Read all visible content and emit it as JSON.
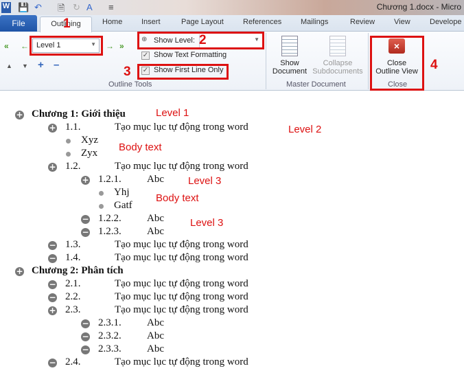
{
  "window": {
    "title": "Chương 1.docx - Micro"
  },
  "tabs": {
    "file": "File",
    "items": [
      "Outlining",
      "Home",
      "Insert",
      "Page Layout",
      "References",
      "Mailings",
      "Review",
      "View",
      "Develope"
    ]
  },
  "ribbon": {
    "outline_tools": {
      "level_value": "Level 1",
      "show_level_label": "Show Level:",
      "show_level_value": "",
      "show_text_formatting": "Show Text Formatting",
      "show_text_formatting_checked": true,
      "show_first_line_only": "Show First Line Only",
      "show_first_line_only_checked": true,
      "group_label": "Outline Tools"
    },
    "master_document": {
      "show_document_1": "Show",
      "show_document_2": "Document",
      "collapse_1": "Collapse",
      "collapse_2": "Subdocuments",
      "group_label": "Master Document"
    },
    "close": {
      "btn_1": "Close",
      "btn_2": "Outline View",
      "group_label": "Close"
    }
  },
  "callouts": [
    "1",
    "2",
    "3",
    "4"
  ],
  "annotations": [
    "Level 1",
    "Level 2",
    "Body text",
    "Level 3",
    "Body text",
    "Level 3"
  ],
  "outline": [
    {
      "level": 1,
      "icon": "plus",
      "num": "",
      "text": "Chương 1: Giới thiệu"
    },
    {
      "level": 2,
      "icon": "plus",
      "num": "1.1.",
      "text": "Tạo mục lục tự động trong word"
    },
    {
      "level": "b2",
      "icon": "bullet",
      "num": "",
      "text": "Xyz"
    },
    {
      "level": "b2",
      "icon": "bullet",
      "num": "",
      "text": "Zyx"
    },
    {
      "level": 2,
      "icon": "plus",
      "num": "1.2.",
      "text": "Tạo mục lục tự động trong word"
    },
    {
      "level": 3,
      "icon": "plus",
      "num": "1.2.1.",
      "text": "Abc"
    },
    {
      "level": "b3",
      "icon": "bullet",
      "num": "",
      "text": "Yhj"
    },
    {
      "level": "b3",
      "icon": "bullet",
      "num": "",
      "text": "Gatf"
    },
    {
      "level": 3,
      "icon": "minus",
      "num": "1.2.2.",
      "text": "Abc"
    },
    {
      "level": 3,
      "icon": "minus",
      "num": "1.2.3.",
      "text": "Abc"
    },
    {
      "level": 2,
      "icon": "minus",
      "num": "1.3.",
      "text": "Tạo mục lục tự động trong word"
    },
    {
      "level": 2,
      "icon": "minus",
      "num": "1.4.",
      "text": "Tạo mục lục tự động trong word"
    },
    {
      "level": 1,
      "icon": "plus",
      "num": "",
      "text": "Chương 2: Phân tích"
    },
    {
      "level": 2,
      "icon": "minus",
      "num": "2.1.",
      "text": " Tạo mục lục tự động trong word"
    },
    {
      "level": 2,
      "icon": "minus",
      "num": "2.2.",
      "text": "Tạo mục lục tự động trong word"
    },
    {
      "level": 2,
      "icon": "plus",
      "num": "2.3.",
      "text": "Tạo mục lục tự động trong word"
    },
    {
      "level": 3,
      "icon": "minus",
      "num": "2.3.1.",
      "text": "Abc"
    },
    {
      "level": 3,
      "icon": "minus",
      "num": "2.3.2.",
      "text": "Abc"
    },
    {
      "level": 3,
      "icon": "minus",
      "num": "2.3.3.",
      "text": "Abc"
    },
    {
      "level": 2,
      "icon": "minus",
      "num": "2.4.",
      "text": "Tạo mục lục tự động trong word"
    }
  ]
}
